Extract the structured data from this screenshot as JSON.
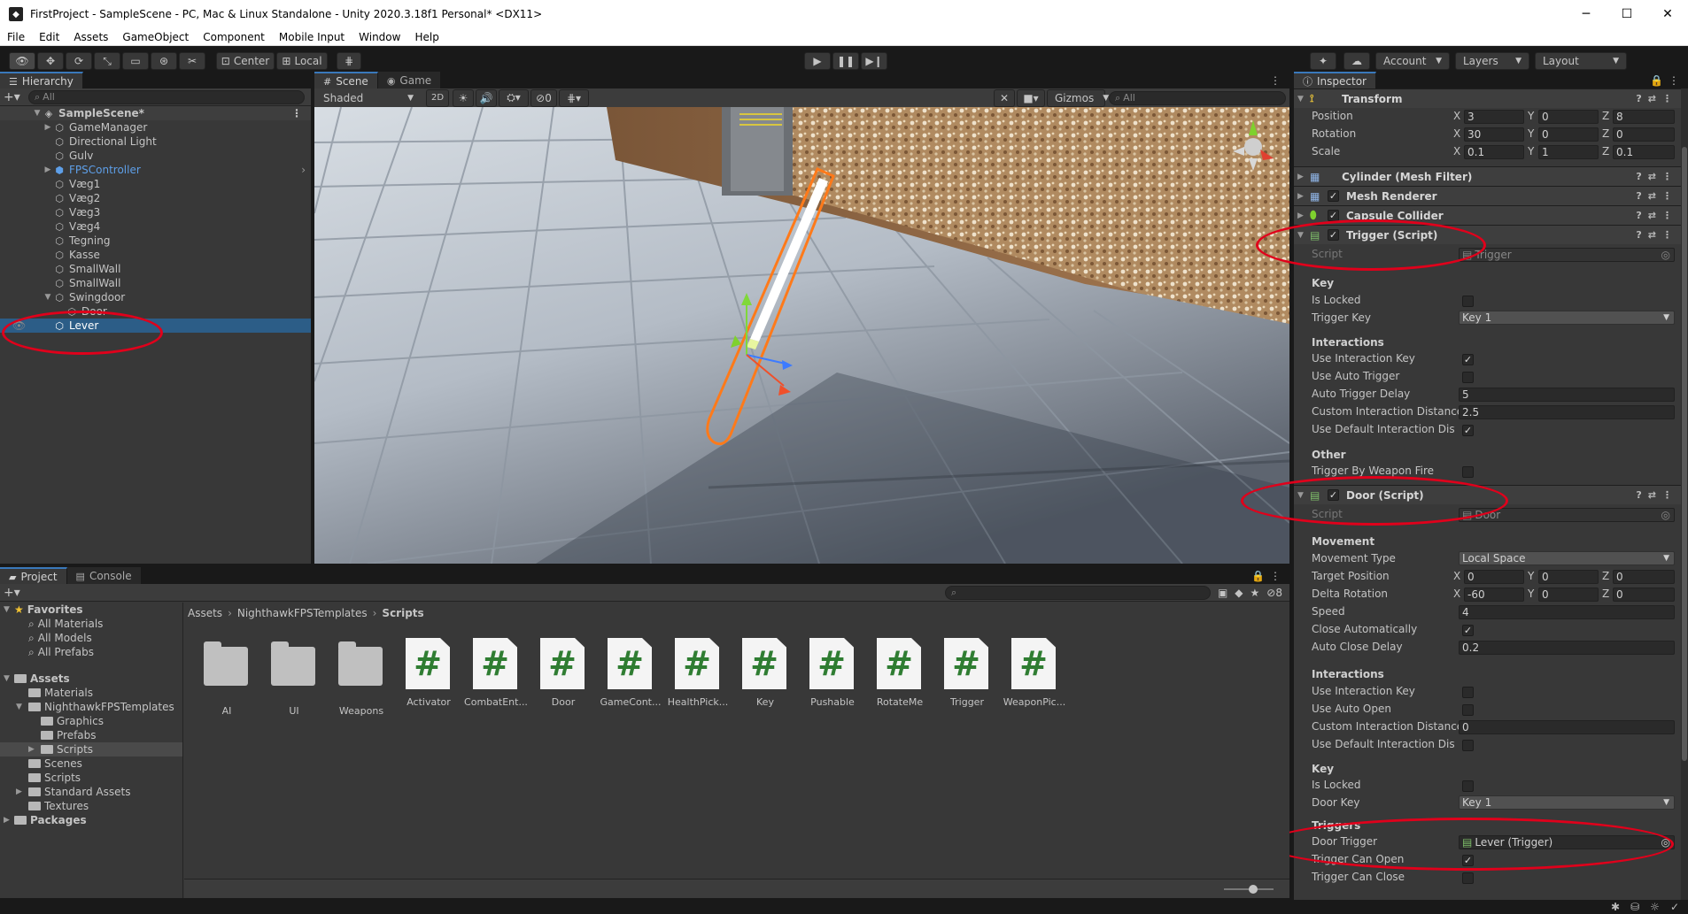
{
  "window": {
    "title": "FirstProject - SampleScene - PC, Mac & Linux Standalone - Unity 2020.3.18f1 Personal* <DX11>"
  },
  "menu": [
    "File",
    "Edit",
    "Assets",
    "GameObject",
    "Component",
    "Mobile Input",
    "Window",
    "Help"
  ],
  "toolbar": {
    "pivot_label": "Center",
    "space_label": "Local",
    "account_label": "Account",
    "layers_label": "Layers",
    "layout_label": "Layout"
  },
  "hierarchy": {
    "tab_label": "Hierarchy",
    "search_placeholder": "All",
    "scene_name": "SampleScene*",
    "items": [
      {
        "label": "GameManager"
      },
      {
        "label": "Directional Light"
      },
      {
        "label": "Gulv"
      },
      {
        "label": "FPSController"
      },
      {
        "label": "Væg1"
      },
      {
        "label": "Væg2"
      },
      {
        "label": "Væg3"
      },
      {
        "label": "Væg4"
      },
      {
        "label": "Tegning"
      },
      {
        "label": "Kasse"
      },
      {
        "label": "SmallWall"
      },
      {
        "label": "SmallWall"
      },
      {
        "label": "Swingdoor"
      },
      {
        "label": "Door"
      },
      {
        "label": "Lever"
      }
    ]
  },
  "scene": {
    "tabs": [
      "Scene",
      "Game"
    ],
    "shading_mode": "Shaded",
    "mode_2d": "2D",
    "fx_count": "0",
    "gizmos_label": "Gizmos",
    "search_placeholder": "All"
  },
  "inspector": {
    "tab_label": "Inspector",
    "transform": {
      "title": "Transform",
      "position_label": "Position",
      "rotation_label": "Rotation",
      "scale_label": "Scale",
      "position": {
        "x": "3",
        "y": "0",
        "z": "8"
      },
      "rotation": {
        "x": "30",
        "y": "0",
        "z": "0"
      },
      "scale": {
        "x": "0.1",
        "y": "1",
        "z": "0.1"
      }
    },
    "components": {
      "mesh_filter": "Cylinder (Mesh Filter)",
      "mesh_renderer": "Mesh Renderer",
      "capsule_collider": "Capsule Collider",
      "trigger_script": "Trigger (Script)",
      "door_script": "Door (Script)"
    },
    "trigger": {
      "script_label": "Script",
      "script_value": "Trigger",
      "key_section": "Key",
      "is_locked_label": "Is Locked",
      "trigger_key_label": "Trigger Key",
      "trigger_key_value": "Key 1",
      "interactions_section": "Interactions",
      "use_interaction_key_label": "Use Interaction Key",
      "use_auto_trigger_label": "Use Auto Trigger",
      "auto_trigger_delay_label": "Auto Trigger Delay",
      "auto_trigger_delay_value": "5",
      "custom_interaction_distance_label": "Custom Interaction Distance",
      "custom_interaction_distance_value": "2.5",
      "use_default_interaction_label": "Use Default Interaction Dista",
      "other_section": "Other",
      "trigger_by_weapon_fire_label": "Trigger By Weapon Fire"
    },
    "door": {
      "script_label": "Script",
      "script_value": "Door",
      "movement_section": "Movement",
      "movement_type_label": "Movement Type",
      "movement_type_value": "Local Space",
      "target_position_label": "Target Position",
      "target_position": {
        "x": "0",
        "y": "0",
        "z": "0"
      },
      "delta_rotation_label": "Delta Rotation",
      "delta_rotation": {
        "x": "-60",
        "y": "0",
        "z": "0"
      },
      "speed_label": "Speed",
      "speed_value": "4",
      "close_automatically_label": "Close Automatically",
      "auto_close_delay_label": "Auto Close Delay",
      "auto_close_delay_value": "0.2",
      "interactions_section": "Interactions",
      "use_interaction_key_label": "Use Interaction Key",
      "use_auto_open_label": "Use Auto Open",
      "custom_interaction_distance_label": "Custom Interaction Distance",
      "custom_interaction_distance_value": "0",
      "use_default_interaction_label": "Use Default Interaction Dista",
      "key_section": "Key",
      "is_locked_label": "Is Locked",
      "door_key_label": "Door Key",
      "door_key_value": "Key 1",
      "triggers_section": "Triggers",
      "door_trigger_label": "Door Trigger",
      "door_trigger_value": "Lever (Trigger)",
      "trigger_can_open_label": "Trigger Can Open",
      "trigger_can_close_label": "Trigger Can Close"
    }
  },
  "project": {
    "tabs": [
      "Project",
      "Console"
    ],
    "hidden_count": "8",
    "sidebar": {
      "favorites": "Favorites",
      "fav_items": [
        "All Materials",
        "All Models",
        "All Prefabs"
      ],
      "assets": "Assets",
      "asset_items": [
        "Materials",
        "NighthawkFPSTemplates",
        "Graphics",
        "Prefabs",
        "Scripts",
        "Scenes",
        "Scripts",
        "Standard Assets",
        "Textures"
      ],
      "packages": "Packages"
    },
    "breadcrumb": [
      "Assets",
      "NighthawkFPSTemplates",
      "Scripts"
    ],
    "assets": [
      {
        "name": "AI",
        "kind": "folder"
      },
      {
        "name": "UI",
        "kind": "folder"
      },
      {
        "name": "Weapons",
        "kind": "folder"
      },
      {
        "name": "Activator",
        "kind": "script"
      },
      {
        "name": "CombatEnt...",
        "kind": "script"
      },
      {
        "name": "Door",
        "kind": "script"
      },
      {
        "name": "GameCont...",
        "kind": "script"
      },
      {
        "name": "HealthPick...",
        "kind": "script"
      },
      {
        "name": "Key",
        "kind": "script"
      },
      {
        "name": "Pushable",
        "kind": "script"
      },
      {
        "name": "RotateMe",
        "kind": "script"
      },
      {
        "name": "Trigger",
        "kind": "script"
      },
      {
        "name": "WeaponPic...",
        "kind": "script"
      }
    ]
  },
  "colors": {
    "selection": "#2c5d87",
    "annotation": "#e0001b",
    "script_hash": "#2f7d32"
  }
}
